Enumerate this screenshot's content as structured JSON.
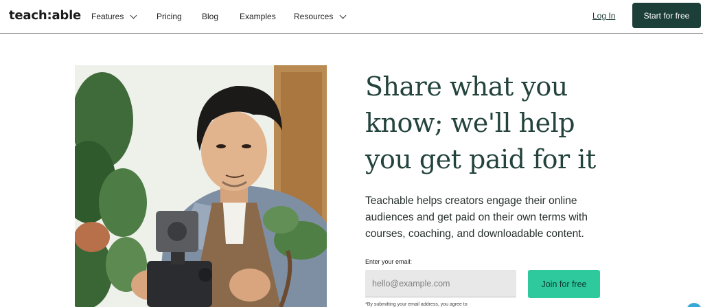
{
  "header": {
    "logo": "teach:able",
    "nav": [
      {
        "label": "Features",
        "has_dropdown": true
      },
      {
        "label": "Pricing",
        "has_dropdown": false
      },
      {
        "label": "Blog",
        "has_dropdown": false
      },
      {
        "label": "Examples",
        "has_dropdown": false
      },
      {
        "label": "Resources",
        "has_dropdown": true
      }
    ],
    "login_label": "Log In",
    "cta_label": "Start for free"
  },
  "hero": {
    "headline_lines": [
      "Share what you",
      "know; we'll help",
      "you get paid for it"
    ],
    "subtext": "Teachable helps creators engage their online audiences and get paid on their own terms with courses, coaching, and downloadable content.",
    "email_label": "Enter your email:",
    "email_placeholder": "hello@example.com",
    "email_value": "",
    "join_label": "Join for free",
    "fineprint": "*By submitting your email address, you agree to"
  },
  "colors": {
    "brand_dark": "#1d3f39",
    "accent_green": "#2ec99c",
    "headline": "#23433c"
  },
  "icons": [
    "chevron-down-icon",
    "chevron-down-icon",
    "help-chat-icon"
  ]
}
